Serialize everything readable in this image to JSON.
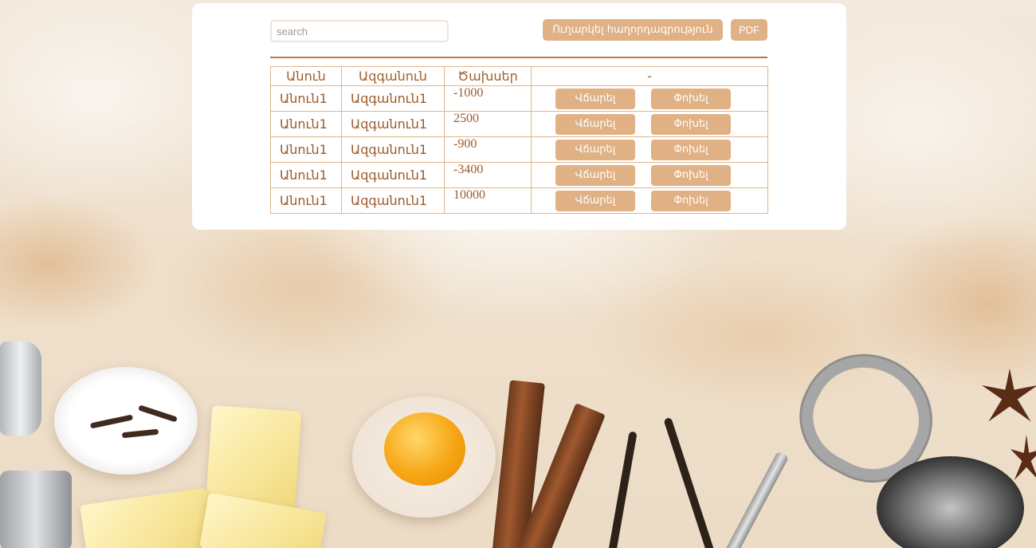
{
  "search": {
    "placeholder": "search",
    "value": ""
  },
  "toolbar": {
    "send_label": "Ուղարկել հաղորդագրություն",
    "pdf_label": "PDF"
  },
  "table": {
    "headers": [
      "Անուն",
      "Ազգանուն",
      "Ծախսեր",
      "-"
    ],
    "rows": [
      {
        "name": "Անուն1",
        "surname": "Ազգանուն1",
        "expense": "-1000"
      },
      {
        "name": "Անուն1",
        "surname": "Ազգանուն1",
        "expense": "2500"
      },
      {
        "name": "Անուն1",
        "surname": "Ազգանուն1",
        "expense": "-900"
      },
      {
        "name": "Անուն1",
        "surname": "Ազգանուն1",
        "expense": "-3400"
      },
      {
        "name": "Անուն1",
        "surname": "Ազգանուն1",
        "expense": "10000"
      }
    ],
    "delete_label": "Վճարել",
    "edit_label": "Փոխել"
  },
  "colors": {
    "accent": "#e0b184",
    "text": "#9b5a2a",
    "border": "#e2b48a",
    "divider": "#b87a48"
  }
}
